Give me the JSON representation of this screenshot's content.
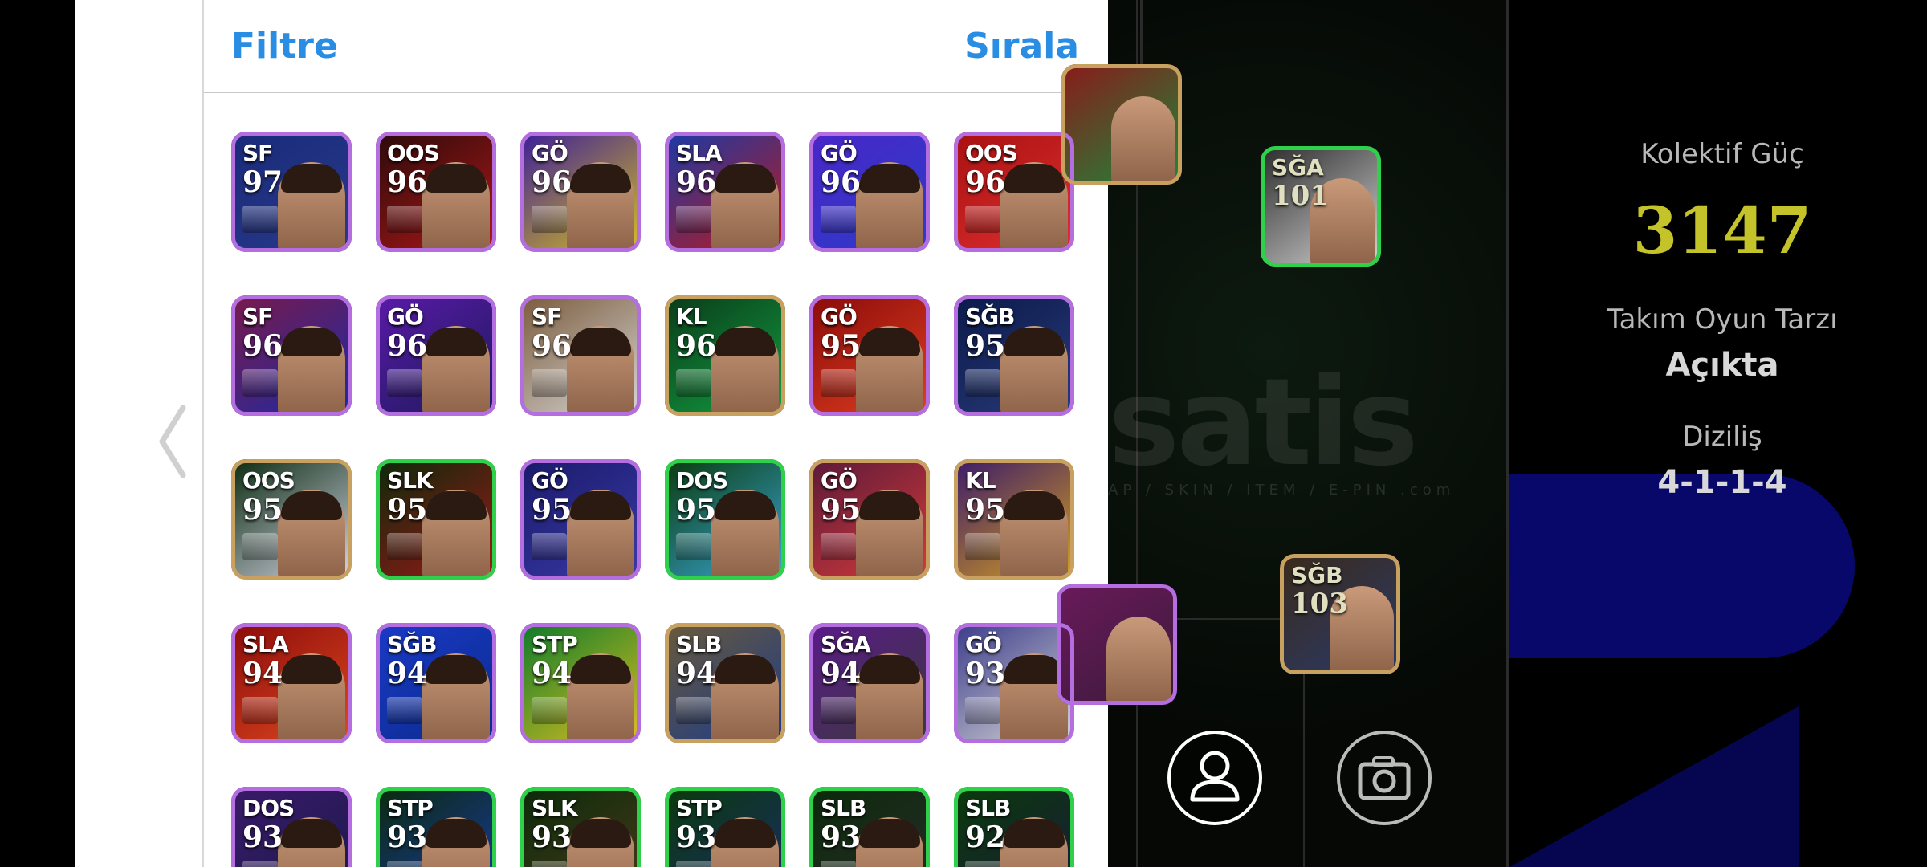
{
  "panel": {
    "filter_label": "Filtre",
    "sort_label": "Sırala"
  },
  "cards": [
    {
      "pos": "SF",
      "rating": "97",
      "c1": "#1a2a7a",
      "c2": "#2a3a8a",
      "rim": "#b46ee0"
    },
    {
      "pos": "OOS",
      "rating": "96",
      "c1": "#2a0a0a",
      "c2": "#b01818",
      "rim": "#b46ee0"
    },
    {
      "pos": "GÖ",
      "rating": "96",
      "c1": "#3b1c9a",
      "c2": "#d8c020",
      "rim": "#b46ee0"
    },
    {
      "pos": "SLA",
      "rating": "96",
      "c1": "#183aa8",
      "c2": "#c01818",
      "rim": "#b46ee0"
    },
    {
      "pos": "GÖ",
      "rating": "96",
      "c1": "#4a26c8",
      "c2": "#2b3cc8",
      "rim": "#b46ee0"
    },
    {
      "pos": "OOS",
      "rating": "96",
      "c1": "#a81010",
      "c2": "#e03030",
      "rim": "#b46ee0"
    },
    {
      "pos": "SF",
      "rating": "96",
      "c1": "#7a1a4a",
      "c2": "#1a2aa8",
      "rim": "#b46ee0"
    },
    {
      "pos": "GÖ",
      "rating": "96",
      "c1": "#5a1aa8",
      "c2": "#1a1a5a",
      "rim": "#b46ee0"
    },
    {
      "pos": "SF",
      "rating": "96",
      "c1": "#7a5a3a",
      "c2": "#d8d8d8",
      "rim": "#b46ee0"
    },
    {
      "pos": "KL",
      "rating": "96",
      "c1": "#0a3a1a",
      "c2": "#12a040",
      "rim": "#c8a060"
    },
    {
      "pos": "GÖ",
      "rating": "95",
      "c1": "#8a0a0a",
      "c2": "#e04020",
      "rim": "#b46ee0"
    },
    {
      "pos": "SĞB",
      "rating": "95",
      "c1": "#0a1a4a",
      "c2": "#2a3a7a",
      "rim": "#b46ee0"
    },
    {
      "pos": "OOS",
      "rating": "95",
      "c1": "#0a2a10",
      "c2": "#d8d8e8",
      "rim": "#c8a060"
    },
    {
      "pos": "SLK",
      "rating": "95",
      "c1": "#0a2a0a",
      "c2": "#a01818",
      "rim": "#2fd04a"
    },
    {
      "pos": "GÖ",
      "rating": "95",
      "c1": "#1a1a6a",
      "c2": "#3a3aa8",
      "rim": "#b46ee0"
    },
    {
      "pos": "DOS",
      "rating": "95",
      "c1": "#0a3a0a",
      "c2": "#3aa8d8",
      "rim": "#2fd04a"
    },
    {
      "pos": "GÖ",
      "rating": "95",
      "c1": "#5a1a3a",
      "c2": "#d83a3a",
      "rim": "#c8a060"
    },
    {
      "pos": "KL",
      "rating": "95",
      "c1": "#3a1a6a",
      "c2": "#d8a020",
      "rim": "#c8a060"
    },
    {
      "pos": "SLA",
      "rating": "94",
      "c1": "#8a0a0a",
      "c2": "#e04a20",
      "rim": "#b46ee0"
    },
    {
      "pos": "SĞB",
      "rating": "94",
      "c1": "#1a3ac8",
      "c2": "#0a2a8a",
      "rim": "#b46ee0"
    },
    {
      "pos": "STP",
      "rating": "94",
      "c1": "#0a7a2a",
      "c2": "#e0c020",
      "rim": "#b46ee0"
    },
    {
      "pos": "SLB",
      "rating": "94",
      "c1": "#6a5a3a",
      "c2": "#1a3a8a",
      "rim": "#c8a060"
    },
    {
      "pos": "SĞA",
      "rating": "94",
      "c1": "#5a1a8a",
      "c2": "#3a3a3a",
      "rim": "#b46ee0"
    },
    {
      "pos": "GÖ",
      "rating": "93",
      "c1": "#3a3a8a",
      "c2": "#d8d8d8",
      "rim": "#b46ee0"
    },
    {
      "pos": "DOS",
      "rating": "93",
      "c1": "#3a1a6a",
      "c2": "#1a1a4a",
      "rim": "#b46ee0"
    },
    {
      "pos": "STP",
      "rating": "93",
      "c1": "#0a2a0a",
      "c2": "#1a3aa8",
      "rim": "#2fd04a"
    },
    {
      "pos": "SLK",
      "rating": "93",
      "c1": "#0a2a0a",
      "c2": "#4a3a1a",
      "rim": "#2fd04a"
    },
    {
      "pos": "STP",
      "rating": "93",
      "c1": "#0a3a0a",
      "c2": "#1a2a6a",
      "rim": "#2fd04a"
    },
    {
      "pos": "SLB",
      "rating": "93",
      "c1": "#0a2a0a",
      "c2": "#2a2a2a",
      "rim": "#2fd04a"
    },
    {
      "pos": "SLB",
      "rating": "92",
      "c1": "#0a3a0a",
      "c2": "#1a1a3a",
      "rim": "#2fd04a"
    }
  ],
  "field": {
    "watermark": "satis",
    "watermark_sub": "AP / SKIN / ITEM / E-PIN .com",
    "cards": [
      {
        "pos": "SĞA",
        "rating": "101",
        "c1": "#2a2a2a",
        "c2": "#d8d8d8",
        "rim": "#2fd04a"
      },
      {
        "pos": "SĞB",
        "rating": "103",
        "c1": "#3a2a1a",
        "c2": "#2a3a6a",
        "rim": "#c8a060"
      }
    ]
  },
  "info": {
    "collective_power_label": "Kolektif Güç",
    "collective_power_value": "3147",
    "play_style_label": "Takım Oyun Tarzı",
    "play_style_value": "Açıkta",
    "formation_label": "Diziliş",
    "formation_value": "4-1-1-4"
  }
}
